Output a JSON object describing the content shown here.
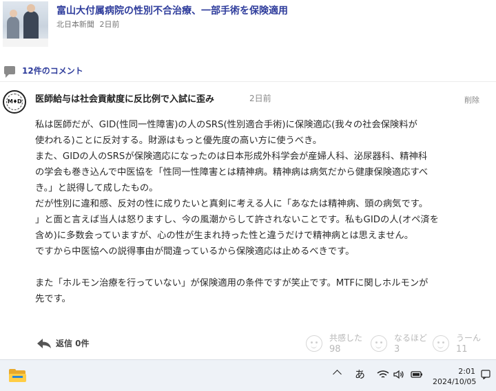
{
  "article": {
    "title": "富山大付属病院の性別不合治療、一部手術を保険適用",
    "source": "北日本新聞",
    "age": "2日前"
  },
  "comments_header": {
    "count_label": "12件のコメント"
  },
  "comment": {
    "avatar_text": "M♦D",
    "title": "医師給与は社会貢献度に反比例で入試に歪み",
    "age": "2日前",
    "delete_label": "削除",
    "lines": [
      "私は医師だが、GID(性同一性障害)の人のSRS(性別適合手術)に保険適応(我々の社会保険料が",
      "使われる)ことに反対する。財源はもっと優先度の高い方に使うべき。",
      "また、GIDの人のSRSが保険適応になったのは日本形成外科学会が産婦人科、泌尿器科、精神科",
      "の学会も巻き込んで中医協を「性同一性障害とは精神病。精神病は病気だから健康保険適応すべ",
      "き。」と説得して成したもの。",
      "だが性別に違和感、反対の性に成りたいと真剣に考える人に「あなたは精神病、頭の病気です。",
      "」と面と言えば当人は怒りますし、今の風潮からして許されないことです。私もGIDの人(オペ済を",
      "含め)に多数会っていますが、心の性が生まれ持った性と違うだけで精神病とは思えません。",
      "ですから中医協への説得事由が間違っているから保険適応は止めるべきです。",
      "",
      "また「ホルモン治療を行っていない」が保険適用の条件ですが笑止です。MTFに関しホルモンが",
      "先です。"
    ],
    "reply_label": "返信 0件",
    "reactions": [
      {
        "label": "共感した",
        "count": "98"
      },
      {
        "label": "なるほど",
        "count": "3"
      },
      {
        "label": "うーん",
        "count": "11"
      }
    ]
  },
  "taskbar": {
    "ime_label": "あ",
    "time": "2:01",
    "date": "2024/10/05"
  }
}
